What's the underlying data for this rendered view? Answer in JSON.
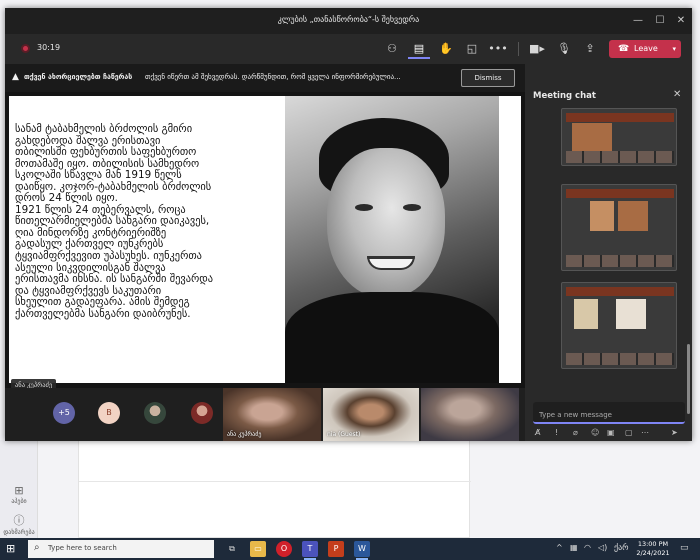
{
  "window": {
    "title": "კლუბის „თანასწორობა“-ს შეხვედრა",
    "minimize": "—",
    "maximize": "☐",
    "close": "✕"
  },
  "toolbar": {
    "timer": "30:19",
    "leave_label": "Leave",
    "icons": [
      "participants-icon",
      "chat-icon",
      "raise-hand-icon",
      "rooms-icon",
      "more-icon",
      "camera-icon",
      "mic-icon",
      "share-icon"
    ]
  },
  "notice": {
    "bold": "თქვენ ახორციელებთ ჩაწერას",
    "message": "თქვენ იწერთ ამ შეხვედრას. დარწმუნდით, რომ ყველა ინფორმირებულია...",
    "dismiss_label": "Dismiss"
  },
  "slide": {
    "lines": [
      "სანამ ტაბახმელის ბრძოლის გმირი",
      "გახდებოდა შალვა ერისთავი",
      "თბილისში ფეხბურთის საფეხბურთო",
      "მოთამაშე იყო. თბილისის სამხედრო",
      "სკოლაში სწავლა მან 1919 წელს",
      "დაიწყო. კოჯორ-ტაბახმელის ბრძოლის",
      "დროს 24 წლის იყო.",
      "1921 წლის 24 თებერვალს, როცა",
      "წითელარმიელებმა სანგარი დაიკავეს,",
      "ღია მინდორზე კონტრიერიშზე",
      "გადასულ ქართველ იუნკრებს",
      "ტყვიამფრქვევით უპასუხეს. იუნკერთა",
      "ასეული სიკვდილისგან შალვა",
      "ერისთავმა იხსნა. ის სანგარში შევარდა",
      "და ტყვიამფრქვევს საკუთარი",
      "სხეულით გადაეფარა. ამის შემდეგ",
      "ქართველებმა სანგარი დაიბრუნეს."
    ],
    "presenter_tag": "ანა კუპრაძე"
  },
  "participants": {
    "more_count": "+5",
    "avatar_b": "B",
    "tiles": [
      {
        "name": "ანა კუპრაძე"
      },
      {
        "name": "nia (Guest)"
      },
      {
        "name": ""
      }
    ]
  },
  "chat": {
    "title": "Meeting chat",
    "close": "✕",
    "input_placeholder": "Type a new message"
  },
  "sidebar": {
    "items": [
      {
        "label": "აპები"
      },
      {
        "label": "დახმარება"
      }
    ]
  },
  "taskbar": {
    "search_placeholder": "Type here to search",
    "time": "13:00 PM",
    "date": "2/24/2021",
    "lang": "ქარ"
  },
  "colors": {
    "leave": "#c4314b",
    "accent": "#7f85f5",
    "meeting_bg": "#1f1f1f"
  }
}
